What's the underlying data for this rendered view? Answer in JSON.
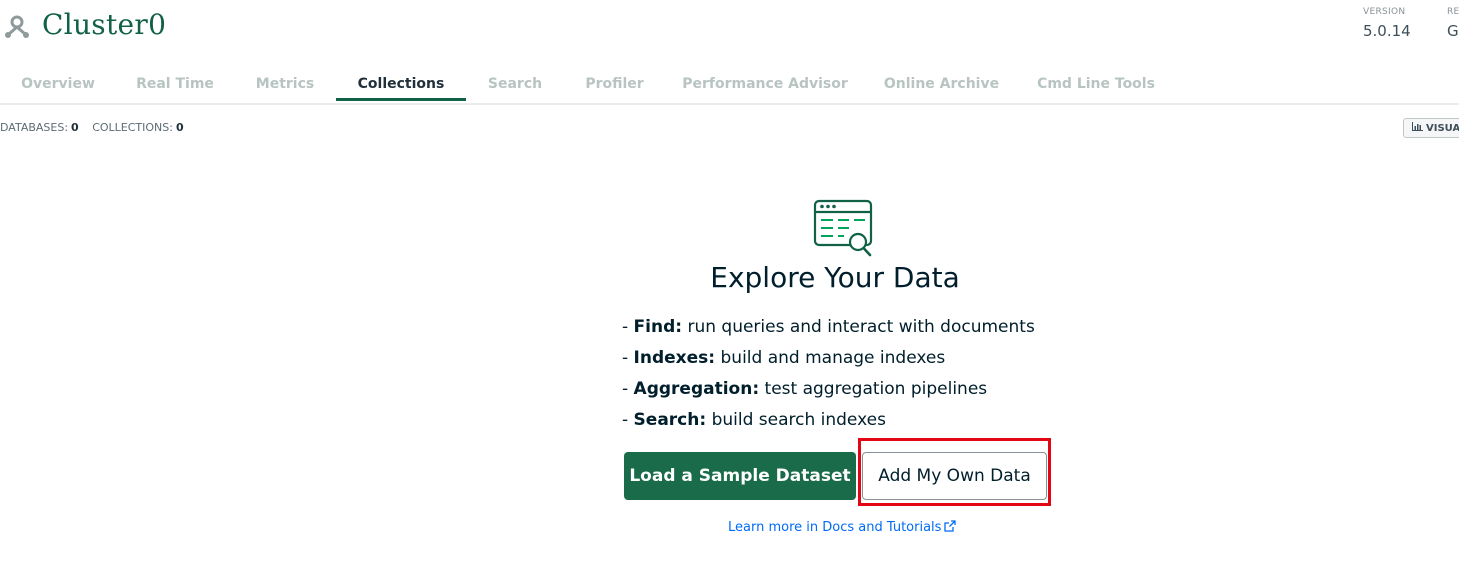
{
  "header": {
    "cluster_name": "Cluster0",
    "cluster_icon": "cluster-icon",
    "version_label": "VERSION",
    "version_value": "5.0.14",
    "region_label": "RE",
    "region_value": "G"
  },
  "tabs": [
    {
      "label": "Overview",
      "active": false
    },
    {
      "label": "Real Time",
      "active": false
    },
    {
      "label": "Metrics",
      "active": false
    },
    {
      "label": "Collections",
      "active": true
    },
    {
      "label": "Search",
      "active": false
    },
    {
      "label": "Profiler",
      "active": false
    },
    {
      "label": "Performance Advisor",
      "active": false
    },
    {
      "label": "Online Archive",
      "active": false
    },
    {
      "label": "Cmd Line Tools",
      "active": false
    }
  ],
  "counts": {
    "databases_label": "DATABASES:",
    "databases_value": "0",
    "collections_label": "COLLECTIONS:",
    "collections_value": "0"
  },
  "visualize_button": {
    "label": "VISUA",
    "icon": "bar-chart-icon"
  },
  "empty_state": {
    "icon": "browse-data-icon",
    "title": "Explore Your Data",
    "features": [
      {
        "term": "Find:",
        "text": "run queries and interact with documents"
      },
      {
        "term": "Indexes:",
        "text": "build and manage indexes"
      },
      {
        "term": "Aggregation:",
        "text": "test aggregation pipelines"
      },
      {
        "term": "Search:",
        "text": "build search indexes"
      }
    ],
    "load_sample_label": "Load a Sample Dataset",
    "add_own_label": "Add My Own Data",
    "docs_link_label": "Learn more in Docs and Tutorials",
    "docs_link_icon": "external-link-icon"
  },
  "colors": {
    "brand_green": "#116149",
    "primary_button": "#1a6b4a",
    "highlight": "#e30613",
    "link_blue": "#016bf8"
  }
}
